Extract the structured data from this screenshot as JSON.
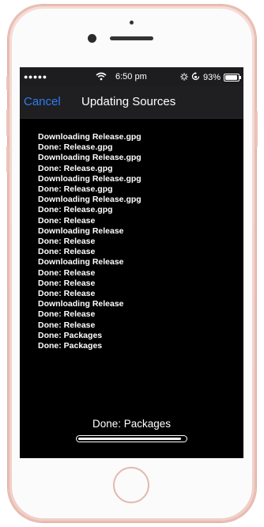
{
  "status_bar": {
    "signal": "●●●●●",
    "time": "6:50 pm",
    "battery_text": "93%",
    "battery_level": 0.93
  },
  "nav": {
    "cancel_label": "Cancel",
    "title": "Updating Sources"
  },
  "log_lines": [
    "Downloading Release.gpg",
    "Done: Release.gpg",
    "Downloading Release.gpg",
    "Done: Release.gpg",
    "Downloading Release.gpg",
    "Done: Release.gpg",
    "Downloading Release.gpg",
    "Done: Release.gpg",
    "Done: Release",
    "Downloading Release",
    "Done: Release",
    "Done: Release",
    "Downloading Release",
    "Done: Release",
    "Done: Release",
    "Done: Release",
    "Downloading Release",
    "Done: Release",
    "Done: Release",
    "Done: Packages",
    "Done: Packages"
  ],
  "footer": {
    "status_text": "Done: Packages",
    "progress": 0.97
  },
  "colors": {
    "accent": "#2d7cf6",
    "screen_bg": "#000000",
    "phone_body": "#f4d5ce"
  }
}
